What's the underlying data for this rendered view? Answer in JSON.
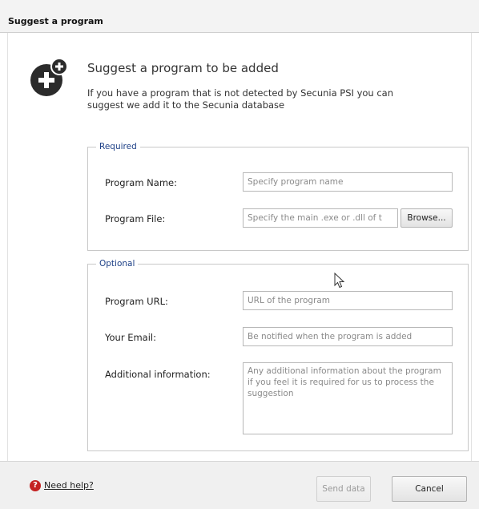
{
  "window": {
    "title": "Suggest a program"
  },
  "header": {
    "icon": "add-plus-icon",
    "heading": "Suggest a program to be added",
    "description": "If you have a program that is not detected by Secunia PSI you can suggest we add it to the Secunia database"
  },
  "required": {
    "legend": "Required",
    "program_name": {
      "label": "Program Name:",
      "placeholder": "Specify program name",
      "value": ""
    },
    "program_file": {
      "label": "Program File:",
      "placeholder": "Specify the main .exe or .dll of t",
      "value": ""
    },
    "browse_label": "Browse..."
  },
  "optional": {
    "legend": "Optional",
    "program_url": {
      "label": "Program URL:",
      "placeholder": "URL of the program",
      "value": ""
    },
    "email": {
      "label": "Your Email:",
      "placeholder": "Be notified when the program is added",
      "value": ""
    },
    "additional": {
      "label": "Additional information:",
      "placeholder": "Any additional information about the program if you feel it is required for us to process the suggestion",
      "value": ""
    }
  },
  "footer": {
    "help_icon": "question-icon",
    "help_label": "Need help?",
    "send_label": "Send data",
    "cancel_label": "Cancel"
  },
  "colors": {
    "legend": "#1c3f86",
    "help_icon": "#c42222"
  }
}
